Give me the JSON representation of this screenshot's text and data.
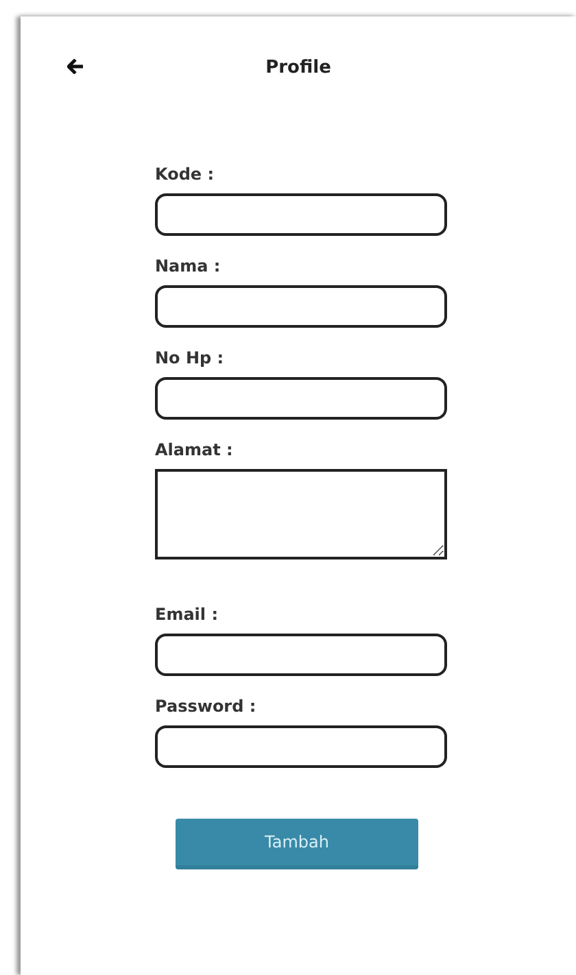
{
  "header": {
    "title": "Profile"
  },
  "fields": [
    {
      "label": "Kode :",
      "kind": "input"
    },
    {
      "label": "Nama :",
      "kind": "input"
    },
    {
      "label": "No Hp :",
      "kind": "input"
    },
    {
      "label": "Alamat :",
      "kind": "textarea"
    },
    {
      "label": "Email :",
      "kind": "input"
    },
    {
      "label": "Password :",
      "kind": "input"
    }
  ],
  "button": {
    "label": "Tambah"
  }
}
